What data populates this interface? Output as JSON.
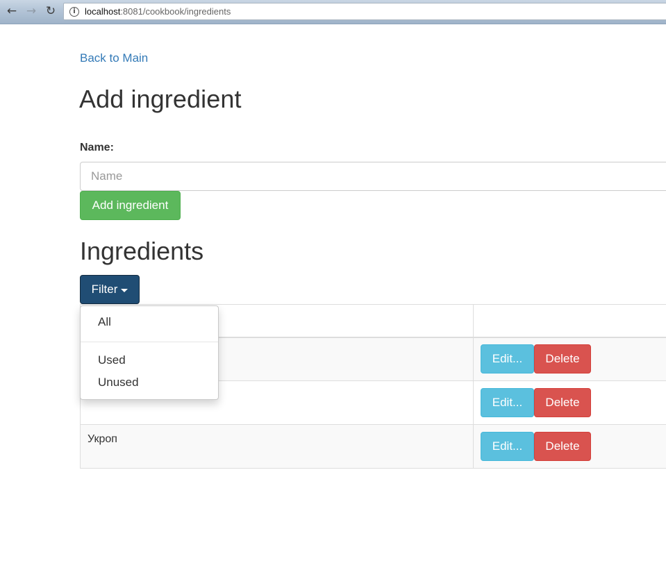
{
  "browser": {
    "url_host": "localhost",
    "url_rest": ":8081/cookbook/ingredients"
  },
  "page": {
    "back_link": "Back to Main",
    "add_title": "Add ingredient",
    "name_label": "Name:",
    "name_placeholder": "Name",
    "name_value": "",
    "add_button": "Add ingredient",
    "list_title": "Ingredients",
    "filter_button": "Filter"
  },
  "filter_menu": {
    "items": [
      "All",
      "Used",
      "Unused"
    ]
  },
  "table": {
    "rows": [
      {
        "name": "",
        "edit": "Edit...",
        "delete": "Delete"
      },
      {
        "name": "Potatoes",
        "edit": "Edit...",
        "delete": "Delete"
      },
      {
        "name": "Укроп",
        "edit": "Edit...",
        "delete": "Delete"
      }
    ]
  },
  "colors": {
    "link": "#337ab7",
    "success": "#5cb85c",
    "filter_active": "#204d74",
    "info": "#5bc0de",
    "danger": "#d9534f"
  }
}
